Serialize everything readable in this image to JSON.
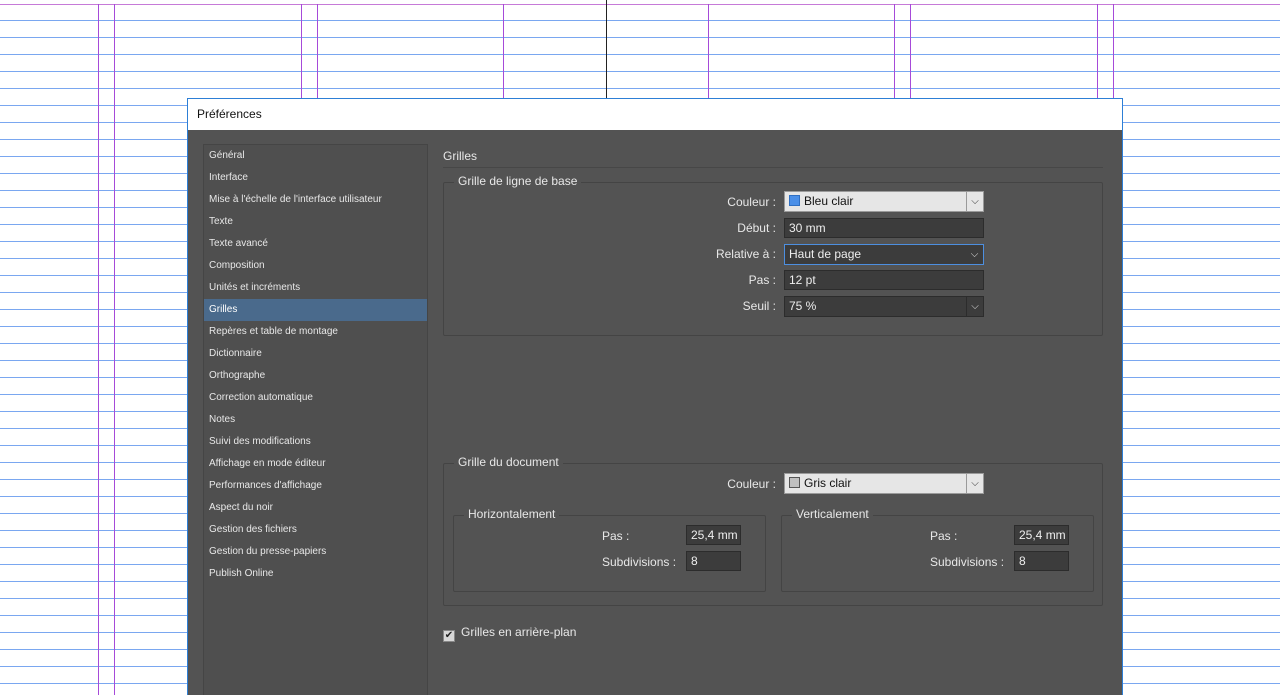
{
  "dialog": {
    "title": "Préférences"
  },
  "sidebar": {
    "items": [
      {
        "label": "Général"
      },
      {
        "label": "Interface"
      },
      {
        "label": "Mise à l'échelle de l'interface utilisateur"
      },
      {
        "label": "Texte"
      },
      {
        "label": "Texte avancé"
      },
      {
        "label": "Composition"
      },
      {
        "label": "Unités et incréments"
      },
      {
        "label": "Grilles"
      },
      {
        "label": "Repères et table de montage"
      },
      {
        "label": "Dictionnaire"
      },
      {
        "label": "Orthographe"
      },
      {
        "label": "Correction automatique"
      },
      {
        "label": "Notes"
      },
      {
        "label": "Suivi des modifications"
      },
      {
        "label": "Affichage en mode éditeur"
      },
      {
        "label": "Performances d'affichage"
      },
      {
        "label": "Aspect du noir"
      },
      {
        "label": "Gestion des fichiers"
      },
      {
        "label": "Gestion du presse-papiers"
      },
      {
        "label": "Publish Online"
      }
    ],
    "selected": "Grilles"
  },
  "section": {
    "title": "Grilles"
  },
  "baseline_grid": {
    "legend": "Grille de ligne de base",
    "color_label": "Couleur :",
    "color_value": "Bleu clair",
    "color_swatch": "#4a8fe8",
    "start_label": "Début :",
    "start_value": "30 mm",
    "relative_label": "Relative à :",
    "relative_value": "Haut de page",
    "increment_label": "Pas :",
    "increment_value": "12 pt",
    "threshold_label": "Seuil :",
    "threshold_value": "75 %"
  },
  "document_grid": {
    "legend": "Grille du document",
    "color_label": "Couleur :",
    "color_value": "Gris clair",
    "color_swatch": "#c0c0c0",
    "horizontal": {
      "legend": "Horizontalement",
      "increment_label": "Pas :",
      "increment_value": "25,4 mm",
      "subdivisions_label": "Subdivisions :",
      "subdivisions_value": "8"
    },
    "vertical": {
      "legend": "Verticalement",
      "increment_label": "Pas :",
      "increment_value": "25,4 mm",
      "subdivisions_label": "Subdivisions :",
      "subdivisions_value": "8"
    }
  },
  "grids_in_back": {
    "label": "Grilles en arrière-plan",
    "checked": true
  },
  "colors": {
    "dialog_bg": "#535353",
    "selection": "#4a6a8c",
    "baseline_grid_line": "#7aa7f0",
    "column_guide": "#a64ad9"
  }
}
